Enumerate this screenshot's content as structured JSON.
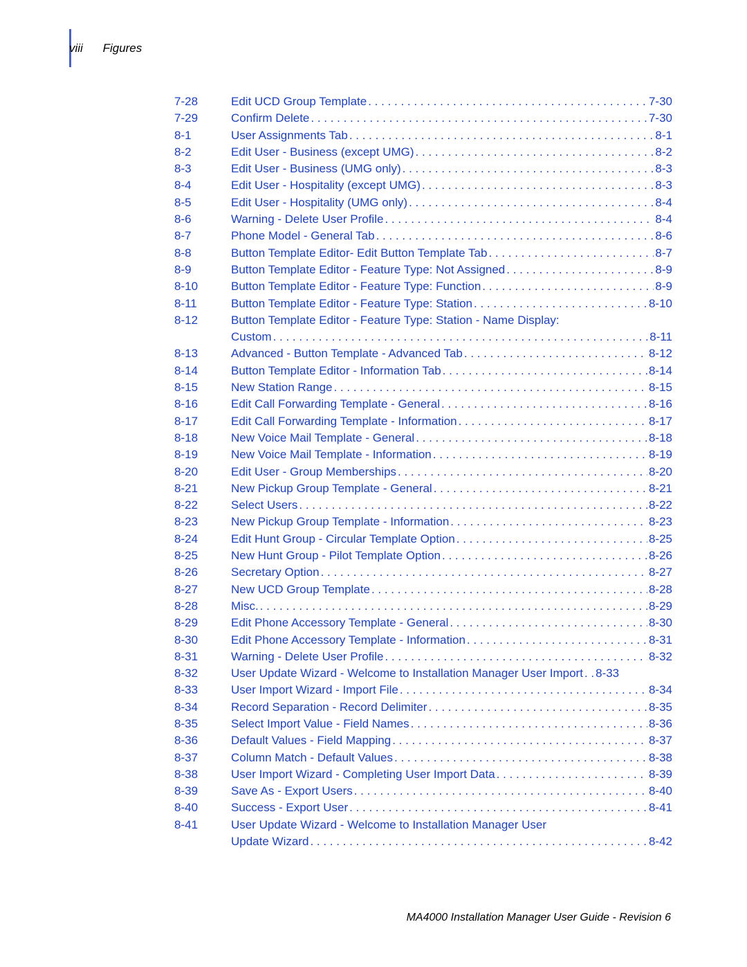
{
  "header": {
    "page_roman": "viii",
    "section_title": "Figures"
  },
  "footer": {
    "text": "MA4000 Installation Manager User Guide - Revision 6"
  },
  "toc": [
    {
      "fig": "7-28",
      "title": "Edit UCD Group Template",
      "page": "7-30"
    },
    {
      "fig": "7-29",
      "title": "Confirm Delete",
      "page": "7-30"
    },
    {
      "fig": "8-1",
      "title": "User Assignments Tab",
      "page": "8-1"
    },
    {
      "fig": "8-2",
      "title": "Edit User - Business (except UMG)",
      "page": "8-2"
    },
    {
      "fig": "8-3",
      "title": "Edit User - Business (UMG only)",
      "page": "8-3"
    },
    {
      "fig": "8-4",
      "title": "Edit User - Hospitality (except UMG)",
      "page": "8-3"
    },
    {
      "fig": "8-5",
      "title": "Edit User - Hospitality (UMG only)",
      "page": "8-4"
    },
    {
      "fig": "8-6",
      "title": "Warning - Delete User Profile",
      "page": "8-4"
    },
    {
      "fig": "8-7",
      "title": "Phone Model - General Tab",
      "page": "8-6"
    },
    {
      "fig": "8-8",
      "title": "Button Template Editor- Edit Button Template Tab",
      "page": "8-7"
    },
    {
      "fig": "8-9",
      "title": "Button Template Editor - Feature Type: Not Assigned",
      "page": "8-9"
    },
    {
      "fig": "8-10",
      "title": "Button Template Editor - Feature Type: Function",
      "page": "8-9"
    },
    {
      "fig": "8-11",
      "title": "Button Template Editor - Feature Type: Station",
      "page": "8-10"
    },
    {
      "fig": "8-12",
      "title": "Button Template Editor - Feature Type: Station - Name Display:",
      "title2": "Custom",
      "page": "8-11"
    },
    {
      "fig": "8-13",
      "title": "Advanced - Button Template - Advanced Tab",
      "page": "8-12"
    },
    {
      "fig": "8-14",
      "title": "Button Template Editor - Information Tab",
      "page": "8-14"
    },
    {
      "fig": "8-15",
      "title": "New Station Range",
      "page": "8-15"
    },
    {
      "fig": "8-16",
      "title": "Edit Call Forwarding Template - General",
      "page": "8-16"
    },
    {
      "fig": "8-17",
      "title": "Edit Call Forwarding Template - Information",
      "page": "8-17"
    },
    {
      "fig": "8-18",
      "title": "New Voice Mail Template - General",
      "page": "8-18"
    },
    {
      "fig": "8-19",
      "title": "New Voice Mail Template - Information",
      "page": "8-19"
    },
    {
      "fig": "8-20",
      "title": "Edit User - Group Memberships",
      "page": "8-20"
    },
    {
      "fig": "8-21",
      "title": "New Pickup Group Template - General",
      "page": "8-21"
    },
    {
      "fig": "8-22",
      "title": "Select Users",
      "page": "8-22"
    },
    {
      "fig": "8-23",
      "title": "New Pickup Group Template - Information",
      "page": "8-23"
    },
    {
      "fig": "8-24",
      "title": "Edit Hunt Group - Circular Template Option",
      "page": "8-25"
    },
    {
      "fig": "8-25",
      "title": "New Hunt Group - Pilot Template Option",
      "page": "8-26"
    },
    {
      "fig": "8-26",
      "title": "Secretary Option",
      "page": "8-27"
    },
    {
      "fig": "8-27",
      "title": "New UCD Group Template",
      "page": "8-28"
    },
    {
      "fig": "8-28",
      "title": "Misc.",
      "page": "8-29"
    },
    {
      "fig": "8-29",
      "title": "Edit Phone Accessory Template - General",
      "page": "8-30"
    },
    {
      "fig": "8-30",
      "title": "Edit Phone Accessory Template - Information",
      "page": "8-31"
    },
    {
      "fig": "8-31",
      "title": "Warning - Delete User Profile",
      "page": "8-32"
    },
    {
      "fig": "8-32",
      "title": "User Update Wizard - Welcome to Installation Manager User Import",
      "page": "8-33",
      "tight": true
    },
    {
      "fig": "8-33",
      "title": "User Import Wizard - Import File",
      "page": "8-34"
    },
    {
      "fig": "8-34",
      "title": "Record Separation - Record Delimiter",
      "page": "8-35"
    },
    {
      "fig": "8-35",
      "title": "Select Import Value - Field Names",
      "page": "8-36"
    },
    {
      "fig": "8-36",
      "title": "Default Values - Field Mapping",
      "page": "8-37"
    },
    {
      "fig": "8-37",
      "title": "Column Match - Default Values",
      "page": "8-38"
    },
    {
      "fig": "8-38",
      "title": "User Import Wizard - Completing User Import Data",
      "page": "8-39"
    },
    {
      "fig": "8-39",
      "title": "Save As - Export Users",
      "page": "8-40"
    },
    {
      "fig": "8-40",
      "title": "Success - Export User",
      "page": "8-41"
    },
    {
      "fig": "8-41",
      "title": "User Update Wizard - Welcome to Installation Manager User",
      "title2": "Update Wizard",
      "page": "8-42"
    }
  ]
}
